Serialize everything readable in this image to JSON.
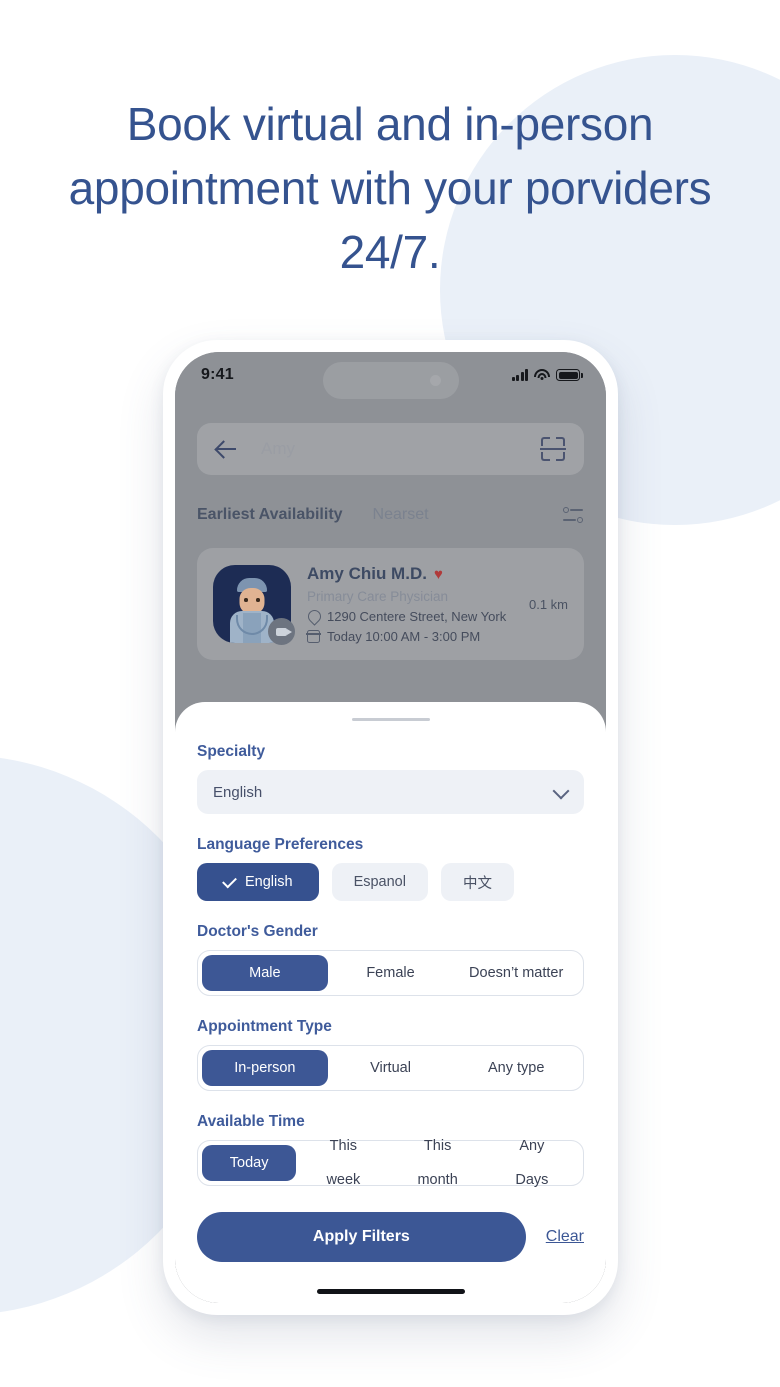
{
  "headline": "Book virtual and in-person appointment with your porviders 24/7.",
  "colors": {
    "accent": "#3C5795",
    "heading": "#35538F",
    "section_label": "#3F5B9B",
    "chip_bg": "#EEF1F6",
    "deco": "#EAF0F8"
  },
  "phone": {
    "status_bar": {
      "time": "9:41",
      "icons": [
        "signal-icon",
        "wifi-icon",
        "battery-icon"
      ]
    },
    "search": {
      "back_icon": "back-arrow-icon",
      "value": "Amy",
      "placeholder": "Amy",
      "scan_icon": "scan-icon"
    },
    "sort": {
      "active": "Earliest Availability",
      "inactive": "Nearset",
      "filter_icon": "filter-sliders-icon"
    },
    "doctor_card": {
      "name": "Amy Chiu M.D.",
      "favorite_icon": "heart-icon",
      "favorite_glyph": "♥",
      "specialty": "Primary Care Physician",
      "address": "1290 Centere Street, New York",
      "hours": "Today 10:00 AM - 3:00 PM",
      "distance": "0.1 km",
      "avatar_icon": "doctor-avatar",
      "video_badge_icon": "video-camera-icon"
    },
    "sheet": {
      "specialty": {
        "label": "Specialty",
        "value": "English",
        "chevron_icon": "chevron-down-icon"
      },
      "language": {
        "label": "Language Preferences",
        "options": [
          {
            "label": "English",
            "selected": true
          },
          {
            "label": "Espanol",
            "selected": false
          },
          {
            "label": "中文",
            "selected": false
          }
        ]
      },
      "gender": {
        "label": "Doctor's Gender",
        "options": [
          {
            "label": "Male",
            "selected": true
          },
          {
            "label": "Female",
            "selected": false
          },
          {
            "label": "Doesn’t matter",
            "selected": false
          }
        ]
      },
      "appointment_type": {
        "label": "Appointment Type",
        "options": [
          {
            "label": "In-person",
            "selected": true
          },
          {
            "label": "Virtual",
            "selected": false
          },
          {
            "label": "Any type",
            "selected": false
          }
        ]
      },
      "available_time": {
        "label": "Available Time",
        "options": [
          {
            "line1": "Today",
            "line2": "",
            "selected": true
          },
          {
            "line1": "This",
            "line2": "week",
            "selected": false
          },
          {
            "line1": "This",
            "line2": "month",
            "selected": false
          },
          {
            "line1": "Any",
            "line2": "Days",
            "selected": false
          }
        ]
      },
      "footer": {
        "apply_label": "Apply Filters",
        "clear_label": "Clear"
      }
    }
  }
}
